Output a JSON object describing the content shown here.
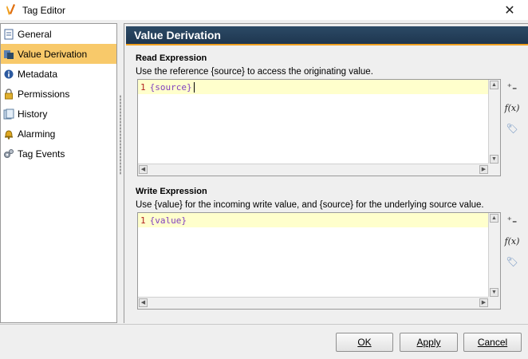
{
  "window": {
    "title": "Tag Editor"
  },
  "sidebar": {
    "items": [
      {
        "label": "General",
        "icon": "document-icon"
      },
      {
        "label": "Value Derivation",
        "icon": "derivation-icon",
        "selected": true
      },
      {
        "label": "Metadata",
        "icon": "info-icon"
      },
      {
        "label": "Permissions",
        "icon": "lock-icon"
      },
      {
        "label": "History",
        "icon": "history-icon"
      },
      {
        "label": "Alarming",
        "icon": "bell-icon"
      },
      {
        "label": "Tag Events",
        "icon": "gears-icon"
      }
    ]
  },
  "main": {
    "header": "Value Derivation",
    "read": {
      "label": "Read Expression",
      "description": "Use the reference {source} to access the originating value.",
      "line_number": "1",
      "code": "{source}"
    },
    "write": {
      "label": "Write Expression",
      "description": "Use {value} for the incoming write value, and {source} for the underlying source value.",
      "line_number": "1",
      "code": "{value}"
    }
  },
  "buttons": {
    "ok": "OK",
    "apply": "Apply",
    "cancel": "Cancel"
  },
  "colors": {
    "selected_bg": "#f8c96a",
    "header_bg": "#1e3650",
    "header_accent": "#f0a020"
  }
}
